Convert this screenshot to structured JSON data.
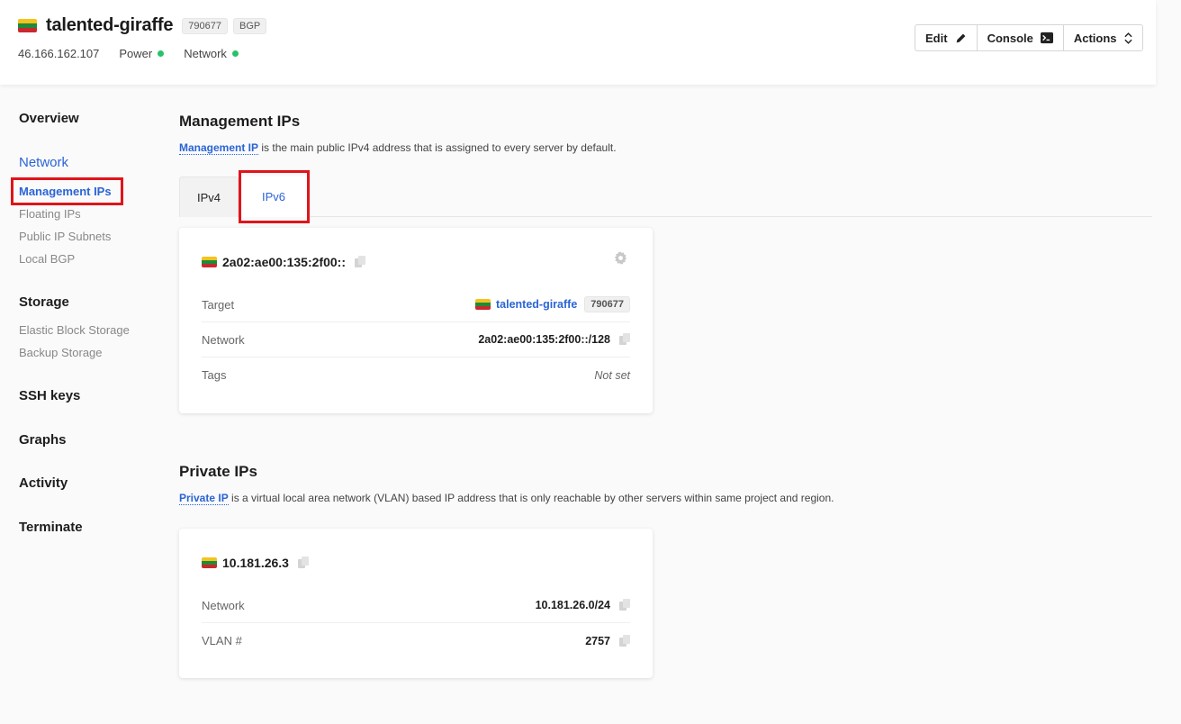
{
  "header": {
    "server_name": "talented-giraffe",
    "server_id": "790677",
    "bgp_badge": "BGP",
    "ip": "46.166.162.107",
    "power_label": "Power",
    "network_label": "Network",
    "status_color": "#27c26b"
  },
  "actions": {
    "edit": "Edit",
    "console": "Console",
    "actions": "Actions"
  },
  "sidebar": {
    "overview": "Overview",
    "network": "Network",
    "management_ips": "Management IPs",
    "floating_ips": "Floating IPs",
    "public_ip_subnets": "Public IP Subnets",
    "local_bgp": "Local BGP",
    "storage": "Storage",
    "elastic_block_storage": "Elastic Block Storage",
    "backup_storage": "Backup Storage",
    "ssh_keys": "SSH keys",
    "graphs": "Graphs",
    "activity": "Activity",
    "terminate": "Terminate"
  },
  "management": {
    "title": "Management IPs",
    "desc_link": "Management IP",
    "desc_text": " is the main public IPv4 address that is assigned to every server by default.",
    "tabs": {
      "ipv4": "IPv4",
      "ipv6": "IPv6"
    },
    "card": {
      "address": "2a02:ae00:135:2f00::",
      "target_label": "Target",
      "target_name": "talented-giraffe",
      "target_id": "790677",
      "network_label": "Network",
      "network_value": "2a02:ae00:135:2f00::/128",
      "tags_label": "Tags",
      "tags_value": "Not set"
    }
  },
  "private": {
    "title": "Private IPs",
    "desc_link": "Private IP",
    "desc_text": " is a virtual local area network (VLAN) based IP address that is only reachable by other servers within same project and region.",
    "card": {
      "address": "10.181.26.3",
      "network_label": "Network",
      "network_value": "10.181.26.0/24",
      "vlan_label": "VLAN #",
      "vlan_value": "2757"
    }
  },
  "colors": {
    "accent": "#2a64d6",
    "highlight": "#e0141a"
  }
}
